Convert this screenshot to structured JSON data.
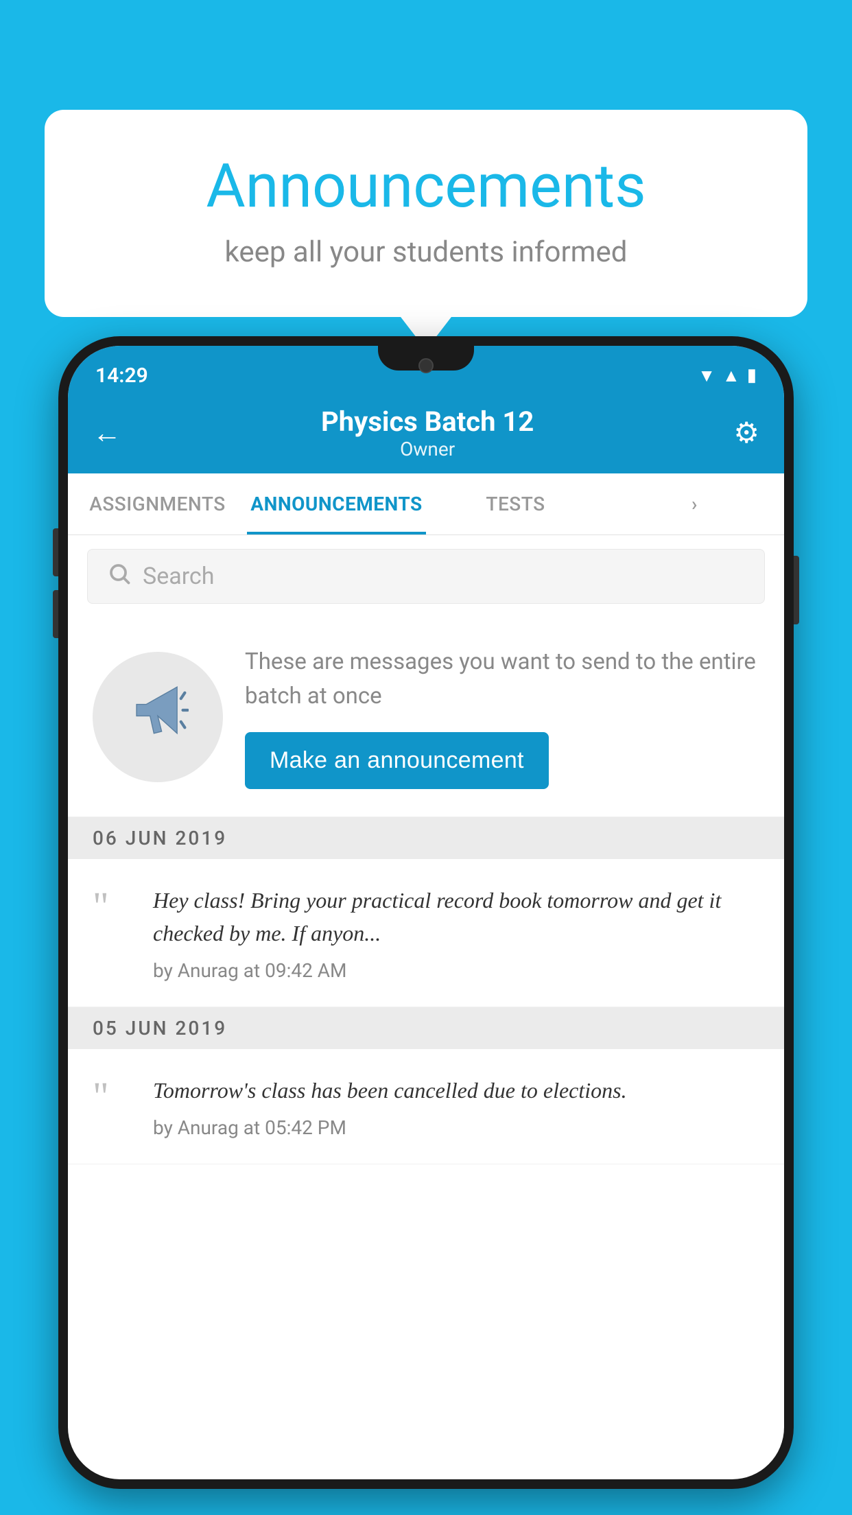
{
  "bubble": {
    "title": "Announcements",
    "subtitle": "keep all your students informed"
  },
  "header": {
    "time": "14:29",
    "title": "Physics Batch 12",
    "subtitle": "Owner",
    "back_label": "←",
    "gear_label": "⚙"
  },
  "tabs": [
    {
      "label": "ASSIGNMENTS",
      "active": false
    },
    {
      "label": "ANNOUNCEMENTS",
      "active": true
    },
    {
      "label": "TESTS",
      "active": false
    },
    {
      "label": "",
      "active": false
    }
  ],
  "search": {
    "placeholder": "Search"
  },
  "announce_prompt": {
    "description": "These are messages you want to send to the entire batch at once",
    "button_label": "Make an announcement"
  },
  "dates": [
    {
      "label": "06  JUN  2019",
      "items": [
        {
          "text": "Hey class! Bring your practical record book tomorrow and get it checked by me. If anyon...",
          "by": "by Anurag at 09:42 AM"
        }
      ]
    },
    {
      "label": "05  JUN  2019",
      "items": [
        {
          "text": "Tomorrow's class has been cancelled due to elections.",
          "by": "by Anurag at 05:42 PM"
        }
      ]
    }
  ],
  "colors": {
    "primary": "#1095c9",
    "background": "#1ab8e8"
  }
}
